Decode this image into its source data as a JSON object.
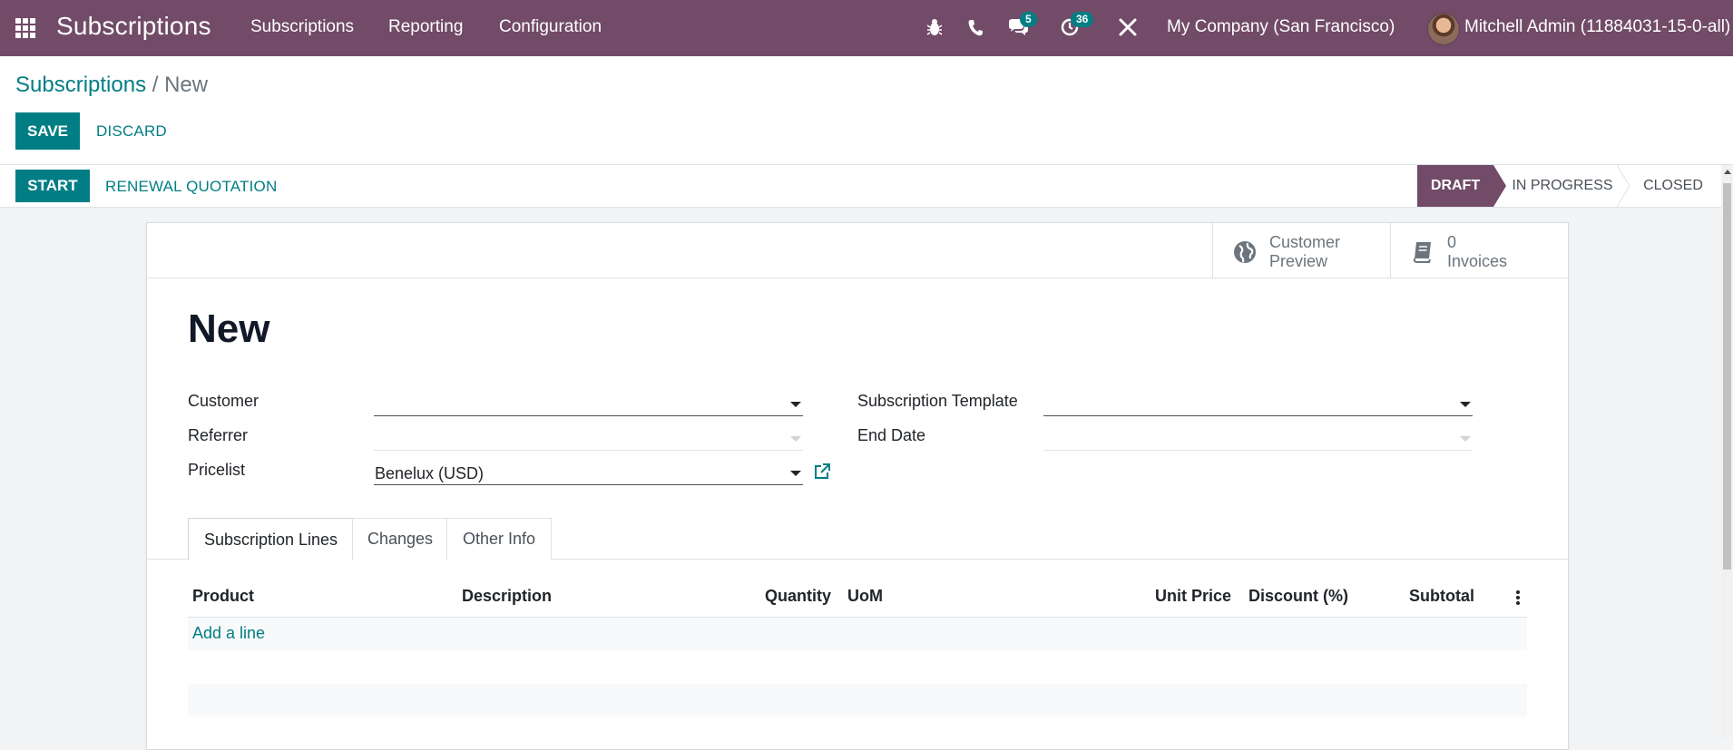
{
  "navbar": {
    "app_name": "Subscriptions",
    "menu": [
      "Subscriptions",
      "Reporting",
      "Configuration"
    ],
    "icons": [
      "apps-icon",
      "bug-icon",
      "phone-icon",
      "chat-icon",
      "activity-clock-icon",
      "tools-icon"
    ],
    "messages_count": "5",
    "activities_count": "36",
    "company": "My Company (San Francisco)",
    "user": "Mitchell Admin (11884031-15-0-all)",
    "color": "#714b67"
  },
  "breadcrumb": {
    "parent": "Subscriptions",
    "separator": "/",
    "current": "New"
  },
  "actions": {
    "save": "SAVE",
    "discard": "DISCARD"
  },
  "header_buttons": {
    "start": "START",
    "renewal": "RENEWAL QUOTATION"
  },
  "statusbar": {
    "stages": [
      "DRAFT",
      "IN PROGRESS",
      "CLOSED"
    ],
    "active": "DRAFT"
  },
  "smart_buttons": {
    "preview_line1": "Customer",
    "preview_line2": "Preview",
    "invoices_count": "0",
    "invoices_label": "Invoices"
  },
  "form": {
    "title": "New",
    "customer_label": "Customer",
    "customer_value": "",
    "referrer_label": "Referrer",
    "referrer_value": "",
    "pricelist_label": "Pricelist",
    "pricelist_value": "Benelux (USD)",
    "template_label": "Subscription Template",
    "template_value": "",
    "end_date_label": "End Date",
    "end_date_value": ""
  },
  "tabs": [
    "Subscription Lines",
    "Changes",
    "Other Info"
  ],
  "active_tab": "Subscription Lines",
  "table": {
    "columns": [
      "Product",
      "Description",
      "Quantity",
      "UoM",
      "Unit Price",
      "Discount (%)",
      "Subtotal"
    ],
    "add_line": "Add a line"
  },
  "colors": {
    "primary": "#017e84",
    "brand": "#714b67"
  }
}
